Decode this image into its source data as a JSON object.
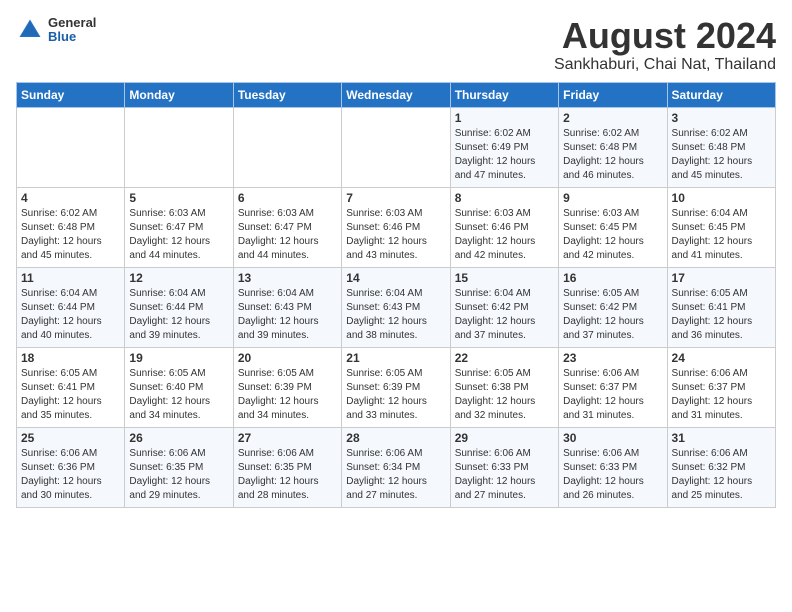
{
  "logo": {
    "general": "General",
    "blue": "Blue"
  },
  "title": "August 2024",
  "subtitle": "Sankhaburi, Chai Nat, Thailand",
  "days_of_week": [
    "Sunday",
    "Monday",
    "Tuesday",
    "Wednesday",
    "Thursday",
    "Friday",
    "Saturday"
  ],
  "weeks": [
    [
      {
        "day": "",
        "content": ""
      },
      {
        "day": "",
        "content": ""
      },
      {
        "day": "",
        "content": ""
      },
      {
        "day": "",
        "content": ""
      },
      {
        "day": "1",
        "content": "Sunrise: 6:02 AM\nSunset: 6:49 PM\nDaylight: 12 hours and 47 minutes."
      },
      {
        "day": "2",
        "content": "Sunrise: 6:02 AM\nSunset: 6:48 PM\nDaylight: 12 hours and 46 minutes."
      },
      {
        "day": "3",
        "content": "Sunrise: 6:02 AM\nSunset: 6:48 PM\nDaylight: 12 hours and 45 minutes."
      }
    ],
    [
      {
        "day": "4",
        "content": "Sunrise: 6:02 AM\nSunset: 6:48 PM\nDaylight: 12 hours and 45 minutes."
      },
      {
        "day": "5",
        "content": "Sunrise: 6:03 AM\nSunset: 6:47 PM\nDaylight: 12 hours and 44 minutes."
      },
      {
        "day": "6",
        "content": "Sunrise: 6:03 AM\nSunset: 6:47 PM\nDaylight: 12 hours and 44 minutes."
      },
      {
        "day": "7",
        "content": "Sunrise: 6:03 AM\nSunset: 6:46 PM\nDaylight: 12 hours and 43 minutes."
      },
      {
        "day": "8",
        "content": "Sunrise: 6:03 AM\nSunset: 6:46 PM\nDaylight: 12 hours and 42 minutes."
      },
      {
        "day": "9",
        "content": "Sunrise: 6:03 AM\nSunset: 6:45 PM\nDaylight: 12 hours and 42 minutes."
      },
      {
        "day": "10",
        "content": "Sunrise: 6:04 AM\nSunset: 6:45 PM\nDaylight: 12 hours and 41 minutes."
      }
    ],
    [
      {
        "day": "11",
        "content": "Sunrise: 6:04 AM\nSunset: 6:44 PM\nDaylight: 12 hours and 40 minutes."
      },
      {
        "day": "12",
        "content": "Sunrise: 6:04 AM\nSunset: 6:44 PM\nDaylight: 12 hours and 39 minutes."
      },
      {
        "day": "13",
        "content": "Sunrise: 6:04 AM\nSunset: 6:43 PM\nDaylight: 12 hours and 39 minutes."
      },
      {
        "day": "14",
        "content": "Sunrise: 6:04 AM\nSunset: 6:43 PM\nDaylight: 12 hours and 38 minutes."
      },
      {
        "day": "15",
        "content": "Sunrise: 6:04 AM\nSunset: 6:42 PM\nDaylight: 12 hours and 37 minutes."
      },
      {
        "day": "16",
        "content": "Sunrise: 6:05 AM\nSunset: 6:42 PM\nDaylight: 12 hours and 37 minutes."
      },
      {
        "day": "17",
        "content": "Sunrise: 6:05 AM\nSunset: 6:41 PM\nDaylight: 12 hours and 36 minutes."
      }
    ],
    [
      {
        "day": "18",
        "content": "Sunrise: 6:05 AM\nSunset: 6:41 PM\nDaylight: 12 hours and 35 minutes."
      },
      {
        "day": "19",
        "content": "Sunrise: 6:05 AM\nSunset: 6:40 PM\nDaylight: 12 hours and 34 minutes."
      },
      {
        "day": "20",
        "content": "Sunrise: 6:05 AM\nSunset: 6:39 PM\nDaylight: 12 hours and 34 minutes."
      },
      {
        "day": "21",
        "content": "Sunrise: 6:05 AM\nSunset: 6:39 PM\nDaylight: 12 hours and 33 minutes."
      },
      {
        "day": "22",
        "content": "Sunrise: 6:05 AM\nSunset: 6:38 PM\nDaylight: 12 hours and 32 minutes."
      },
      {
        "day": "23",
        "content": "Sunrise: 6:06 AM\nSunset: 6:37 PM\nDaylight: 12 hours and 31 minutes."
      },
      {
        "day": "24",
        "content": "Sunrise: 6:06 AM\nSunset: 6:37 PM\nDaylight: 12 hours and 31 minutes."
      }
    ],
    [
      {
        "day": "25",
        "content": "Sunrise: 6:06 AM\nSunset: 6:36 PM\nDaylight: 12 hours and 30 minutes."
      },
      {
        "day": "26",
        "content": "Sunrise: 6:06 AM\nSunset: 6:35 PM\nDaylight: 12 hours and 29 minutes."
      },
      {
        "day": "27",
        "content": "Sunrise: 6:06 AM\nSunset: 6:35 PM\nDaylight: 12 hours and 28 minutes."
      },
      {
        "day": "28",
        "content": "Sunrise: 6:06 AM\nSunset: 6:34 PM\nDaylight: 12 hours and 27 minutes."
      },
      {
        "day": "29",
        "content": "Sunrise: 6:06 AM\nSunset: 6:33 PM\nDaylight: 12 hours and 27 minutes."
      },
      {
        "day": "30",
        "content": "Sunrise: 6:06 AM\nSunset: 6:33 PM\nDaylight: 12 hours and 26 minutes."
      },
      {
        "day": "31",
        "content": "Sunrise: 6:06 AM\nSunset: 6:32 PM\nDaylight: 12 hours and 25 minutes."
      }
    ]
  ],
  "colors": {
    "header_bg": "#2472c4",
    "accent": "#1a5fa8"
  }
}
